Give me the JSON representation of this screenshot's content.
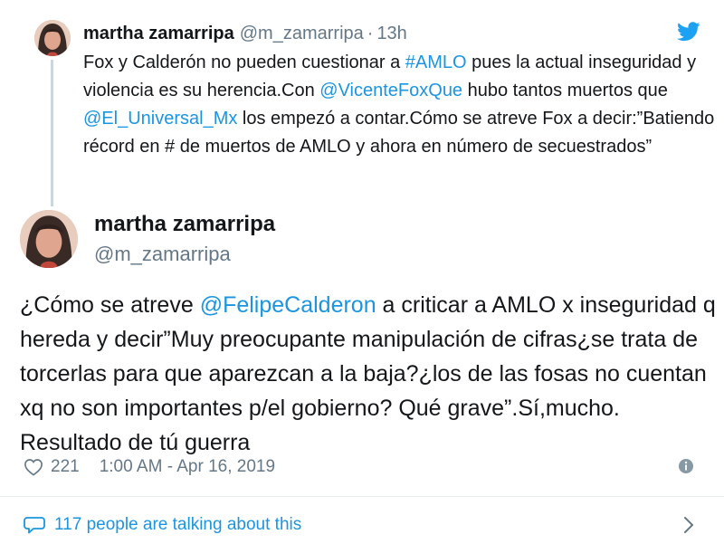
{
  "colors": {
    "link": "#1b95e0",
    "muted": "#657786",
    "text": "#14171a",
    "divider": "#e6ecf0"
  },
  "icons": {
    "brand": "twitter-bird-icon",
    "like": "heart-icon",
    "info": "info-icon",
    "conversation": "speech-bubble-icon",
    "more": "chevron-right-icon"
  },
  "parent_tweet": {
    "name": "martha zamarripa",
    "handle": "@m_zamarripa",
    "separator": "·",
    "time": "13h",
    "text_parts": {
      "t1": "Fox y Calderón no pueden cuestionar a ",
      "hashtag": "#AMLO",
      "t2": " pues la actual inseguridad y violencia es su herencia.Con ",
      "mention1": "@VicenteFoxQue",
      "t3": " hubo tantos muertos que ",
      "mention2": "@El_Universal_Mx",
      "t4": " los empezó a contar.Cómo se atreve Fox a decir:”Batiendo récord en # de muertos de AMLO y ahora en número de secuestrados”"
    }
  },
  "main_tweet": {
    "name": "martha zamarripa",
    "handle": "@m_zamarripa",
    "text_parts": {
      "t1": "¿Cómo se atreve ",
      "mention": "@FelipeCalderon",
      "t2": " a criticar a AMLO x inseguridad q hereda y decir”Muy preocupante manipulación de cifras¿se trata de torcerlas para que aparezcan a la baja?¿los de las fosas no cuentan xq no son importantes p/el gobierno? Qué grave”.Sí,mucho. Resultado de tú guerra"
    },
    "likes": "221",
    "timestamp": "1:00 AM - Apr 16, 2019"
  },
  "footer": {
    "talking": "117 people are talking about this"
  }
}
